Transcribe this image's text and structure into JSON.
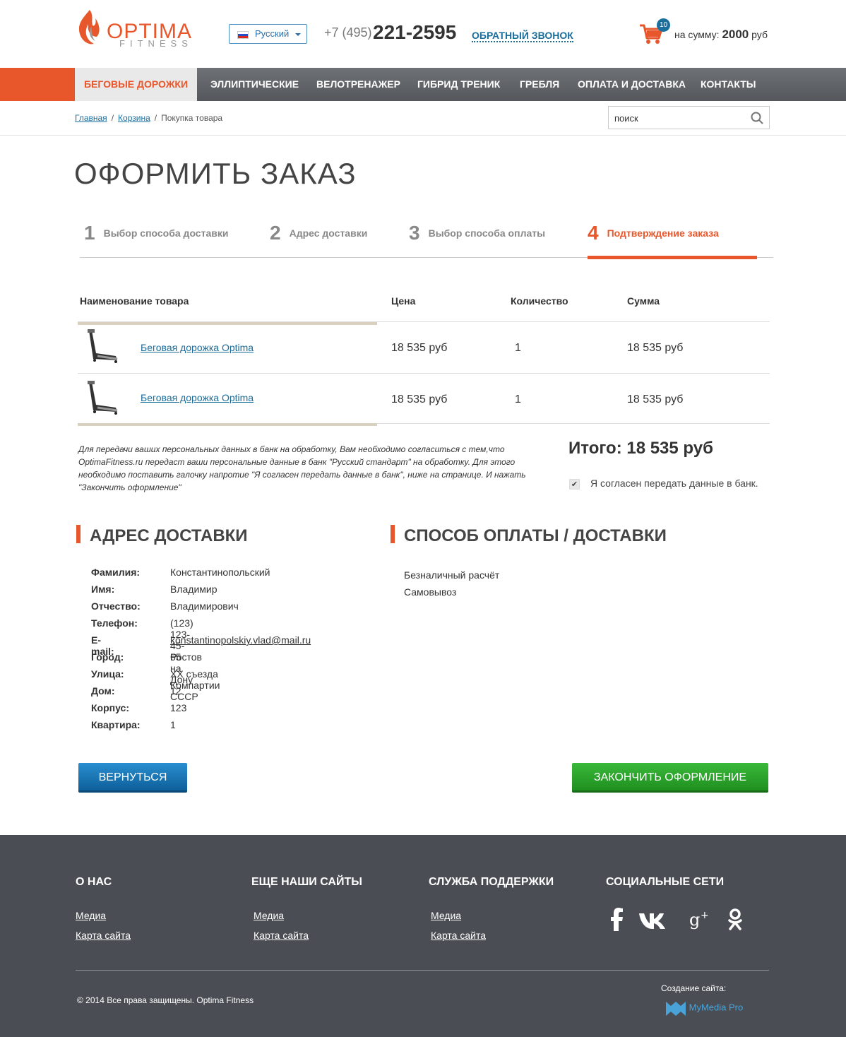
{
  "header": {
    "logo_name": "OPTIMA",
    "logo_sub": "FITNESS",
    "lang": "Русский",
    "phone_prefix": "+7 (495)",
    "phone": "221-2595",
    "callback": "ОБРАТНЫЙ ЗВОНОК",
    "cart_count": "10",
    "cart_label": "на сумму:",
    "cart_sum": "2000",
    "cart_cur": "руб"
  },
  "nav": [
    "БЕГОВЫЕ ДОРОЖКИ",
    "ЭЛЛИПТИЧЕСКИЕ",
    "ВЕЛОТРЕНАЖЕР",
    "ГИБРИД ТРЕНИК",
    "ГРЕБЛЯ",
    "ОПЛАТА И ДОСТАВКА",
    "КОНТАКТЫ"
  ],
  "breadcrumb": {
    "home": "Главная",
    "cart": "Корзина",
    "current": "Покупка товара",
    "sep": "/"
  },
  "search": {
    "placeholder": "поиск"
  },
  "page_title": "ОФОРМИТЬ ЗАКАЗ",
  "steps": [
    {
      "num": "1",
      "label": "Выбор способа доставки"
    },
    {
      "num": "2",
      "label": "Адрес доставки"
    },
    {
      "num": "3",
      "label": "Выбор способа оплаты"
    },
    {
      "num": "4",
      "label": "Подтверждение заказа"
    }
  ],
  "table": {
    "headers": [
      "Наименование товара",
      "Цена",
      "Количество",
      "Сумма"
    ],
    "rows": [
      {
        "name": "Беговая дорожка Optima",
        "price": "18 535 руб",
        "qty": "1",
        "sum": "18 535 руб"
      },
      {
        "name": "Беговая дорожка Optima",
        "price": "18 535 руб",
        "qty": "1",
        "sum": "18 535 руб"
      }
    ]
  },
  "note": "Для передачи ваших персональных данных в банк на обработку, Вам необходимо согласиться с тем,что OptimaFitness.ru передаст ваши персональные данные в банк \"Русский стандарт\" на обработку. Для этого необходимо поставить галочку напротие \"Я согласен передать данные в банк\", ниже на странице. И нажать \"Закончить оформление\"",
  "total": "Итого: 18 535 руб",
  "agree_label": "Я согласен передать данные в банк.",
  "address": {
    "title": "АДРЕС ДОСТАВКИ",
    "fields": [
      {
        "k": "Фамилия:",
        "v": "Константинопольский"
      },
      {
        "k": "Имя:",
        "v": "Владимир"
      },
      {
        "k": "Отчество:",
        "v": "Владимирович"
      },
      {
        "k": "Телефон:",
        "v": "(123) 123-45-65"
      },
      {
        "k": "E-mail:",
        "v": "konstantinopolskiy.vlad@mail.ru"
      },
      {
        "k": "Город:",
        "v": "Ростов на Дону"
      },
      {
        "k": "Улица:",
        "v": "ХХ съезда Компартии СССР"
      },
      {
        "k": "Дом:",
        "v": "12"
      },
      {
        "k": "Корпус:",
        "v": "123"
      },
      {
        "k": "Квартира:",
        "v": "1"
      }
    ]
  },
  "payment": {
    "title": "СПОСОБ ОПЛАТЫ / ДОСТАВКИ",
    "method": "Безналичный расчёт",
    "delivery": "Самовывоз"
  },
  "buttons": {
    "back": "ВЕРНУТЬСЯ",
    "finish": "ЗАКОНЧИТЬ ОФОРМЛЕНИЕ"
  },
  "footer": {
    "cols": [
      {
        "title": "О НАС",
        "links": [
          "Медиа",
          "Карта сайта"
        ]
      },
      {
        "title": "ЕЩЕ НАШИ САЙТЫ",
        "links": [
          "Медиа",
          "Карта сайта"
        ]
      },
      {
        "title": "СЛУЖБА ПОДДЕРЖКИ",
        "links": [
          "Медиа",
          "Карта сайта"
        ]
      },
      {
        "title": "СОЦИАЛЬНЫЕ СЕТИ"
      }
    ],
    "social_icons": [
      "facebook-icon",
      "vk-icon",
      "google-plus-icon",
      "odnoklassniki-icon"
    ],
    "copyright": "© 2014 Все права защищены. Optima Fitness",
    "made_by": "Создание сайта:",
    "studio": "MyMedia Pro"
  },
  "colors": {
    "accent": "#e8572b",
    "link": "#1a6e9c",
    "footer": "#4a4e54",
    "finish": "#2ea32e",
    "back": "#1b75b5"
  }
}
